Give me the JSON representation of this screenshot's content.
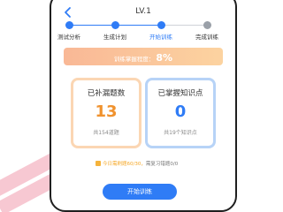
{
  "header": {
    "title": "LV.1"
  },
  "steps": [
    {
      "label": "测试分析",
      "state": "done"
    },
    {
      "label": "生成计划",
      "state": "done"
    },
    {
      "label": "开始训练",
      "state": "active"
    },
    {
      "label": "完成训练",
      "state": "pending"
    }
  ],
  "progress": {
    "label": "训练掌握程度：",
    "value": "8%"
  },
  "cards": {
    "leaks": {
      "title": "已补漏题数",
      "value": "13",
      "sub": "共154道题"
    },
    "knowledge": {
      "title": "已掌握知识点",
      "value": "0",
      "sub": "共19个知识点"
    }
  },
  "tip": {
    "highlight": "今日需刷题60/30，",
    "rest": "需复习错题0/0"
  },
  "start_button": {
    "label": "开始训练"
  },
  "colors": {
    "accent": "#2f7cf6",
    "orange": "#f0922e",
    "progress_gradient_start": "#f9b896",
    "progress_gradient_end": "#fcd3a0",
    "background_stripe": "#f7c8d2"
  }
}
